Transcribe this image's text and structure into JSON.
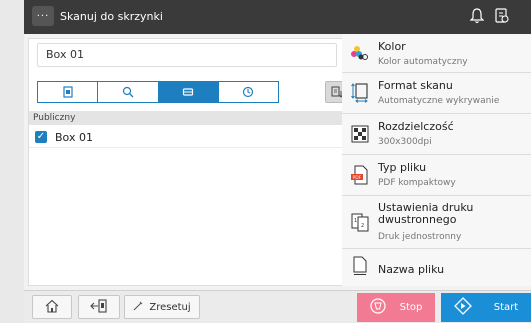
{
  "header": {
    "menu_label": "···",
    "title": "Skanuj do skrzynki"
  },
  "left": {
    "box_value": "Box 01",
    "section_label": "Publiczny",
    "rows": [
      {
        "label": "Box 01",
        "checked": true
      }
    ]
  },
  "settings": [
    {
      "title": "Kolor",
      "sub": "Kolor automatyczny",
      "icon": "color-icon"
    },
    {
      "title": "Format skanu",
      "sub": "Automatyczne wykrywanie",
      "icon": "scan-size-icon"
    },
    {
      "title": "Rozdzielczość",
      "sub": "300x300dpi",
      "icon": "resolution-icon"
    },
    {
      "title": "Typ pliku",
      "sub": "PDF kompaktowy",
      "icon": "pdf-file-icon"
    },
    {
      "title": "Ustawienia druku dwustronnego",
      "sub": "Druk jednostronny",
      "icon": "duplex-icon"
    },
    {
      "title": "Nazwa pliku",
      "sub": "",
      "icon": "file-name-icon"
    }
  ],
  "bottom": {
    "reset_label": "Zresetuj",
    "stop_label": "Stop",
    "start_label": "Start"
  },
  "colors": {
    "accent": "#1d7fbf",
    "stop": "#f37a93",
    "start": "#1a8fd8",
    "topbar": "#3a3a3a"
  }
}
